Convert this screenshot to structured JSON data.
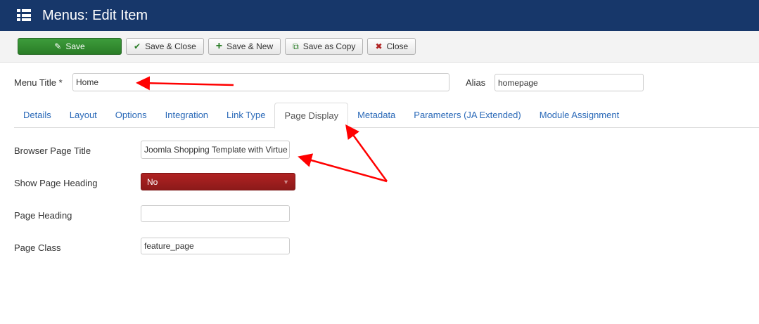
{
  "header": {
    "title": "Menus: Edit Item",
    "icon": "menu-list-icon"
  },
  "toolbar": {
    "save": "Save",
    "save_close": "Save & Close",
    "save_new": "Save & New",
    "save_copy": "Save as Copy",
    "close": "Close"
  },
  "form": {
    "menu_title_label": "Menu Title *",
    "menu_title_value": "Home",
    "alias_label": "Alias",
    "alias_value": "homepage"
  },
  "tabs": [
    "Details",
    "Layout",
    "Options",
    "Integration",
    "Link Type",
    "Page Display",
    "Metadata",
    "Parameters (JA Extended)",
    "Module Assignment"
  ],
  "page_display": {
    "browser_title_label": "Browser Page Title",
    "browser_title_value": "Joomla Shopping Template with Virtue",
    "show_heading_label": "Show Page Heading",
    "show_heading_value": "No",
    "heading_label": "Page Heading",
    "heading_value": "",
    "class_label": "Page Class",
    "class_value": "feature_page"
  },
  "colors": {
    "header": "#17376a",
    "save": "#2f8a2d",
    "select": "#a01f1f",
    "annotation": "#ff0000"
  }
}
